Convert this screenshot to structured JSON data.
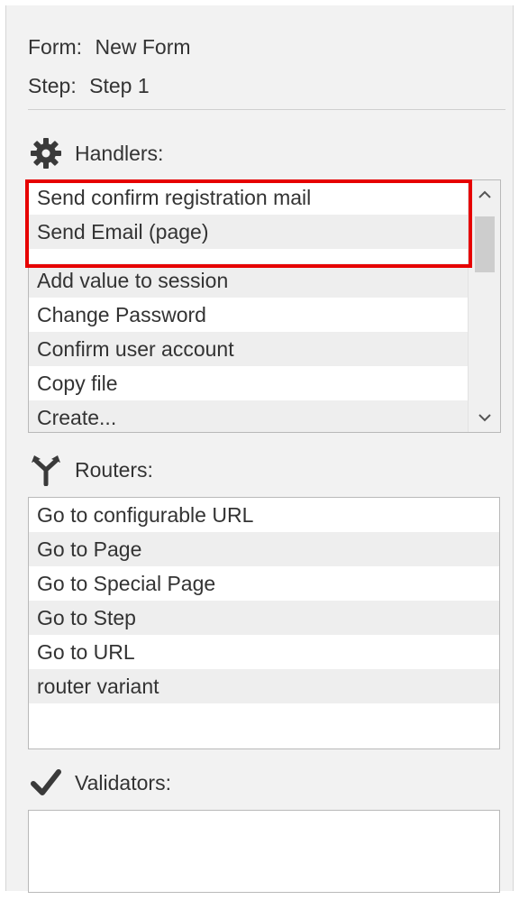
{
  "form_info": {
    "form_key": "Form:",
    "form_value": "New Form",
    "step_key": "Step:",
    "step_value": "Step 1"
  },
  "handlers": {
    "title": "Handlers:",
    "icon": "gear-icon",
    "selected_items": [
      "Send confirm registration mail",
      "Send Email (page)"
    ],
    "items": [
      "Add value to session",
      "Change Password",
      "Confirm user account",
      "Copy file",
      "Create..."
    ]
  },
  "routers": {
    "title": "Routers:",
    "icon": "router-fork-icon",
    "items": [
      "Go to configurable URL",
      "Go to Page",
      "Go to Special Page",
      "Go to Step",
      "Go to URL",
      "router variant"
    ]
  },
  "validators": {
    "title": "Validators:",
    "icon": "checkmark-icon",
    "items": []
  },
  "colors": {
    "highlight": "#e60000",
    "panel": "#f2f2f2"
  }
}
